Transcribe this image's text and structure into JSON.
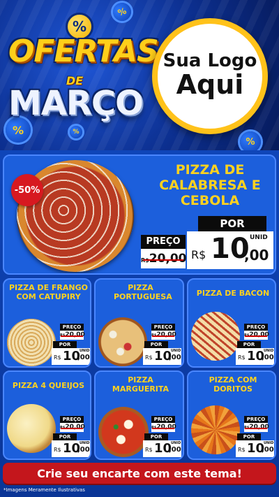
{
  "header": {
    "badge_symbol": "%",
    "title_line1": "OFERTAS",
    "title_line2": "DE",
    "title_line3": "MARÇO",
    "logo_line1": "Sua Logo",
    "logo_line2": "Aqui"
  },
  "featured": {
    "discount": "-50%",
    "name": "PIZZA DE CALABRESA E CEBOLA",
    "old_label": "PREÇO",
    "old_currency": "R$",
    "old_price": "20,00",
    "new_label": "POR",
    "unit": "UNID",
    "currency": "R$",
    "price_int": "10",
    "price_dec": ",00"
  },
  "products": [
    {
      "name": "PIZZA DE FRANGO COM CATUPIRY",
      "old_label": "PREÇO",
      "old_currency": "R$",
      "old_price": "20,00",
      "new_label": "POR",
      "unit": "UNID",
      "currency": "R$",
      "price_int": "10",
      "price_dec": ",00"
    },
    {
      "name": "PIZZA PORTUGUESA",
      "old_label": "PREÇO",
      "old_currency": "R$",
      "old_price": "20,00",
      "new_label": "POR",
      "unit": "UNID",
      "currency": "R$",
      "price_int": "10",
      "price_dec": ",00"
    },
    {
      "name": "PIZZA DE BACON",
      "old_label": "PREÇO",
      "old_currency": "R$",
      "old_price": "20,00",
      "new_label": "POR",
      "unit": "UNID",
      "currency": "R$",
      "price_int": "10",
      "price_dec": ",00"
    },
    {
      "name": "PIZZA 4 QUEIJOS",
      "old_label": "PREÇO",
      "old_currency": "R$",
      "old_price": "20,00",
      "new_label": "POR",
      "unit": "UNID",
      "currency": "R$",
      "price_int": "10",
      "price_dec": ",00"
    },
    {
      "name": "PIZZA MARGUERITA",
      "old_label": "PREÇO",
      "old_currency": "R$",
      "old_price": "20,00",
      "new_label": "POR",
      "unit": "UNID",
      "currency": "R$",
      "price_int": "10",
      "price_dec": ",00"
    },
    {
      "name": "PIZZA COM DORITOS",
      "old_label": "PREÇO",
      "old_currency": "R$",
      "old_price": "20,00",
      "new_label": "POR",
      "unit": "UNID",
      "currency": "R$",
      "price_int": "10",
      "price_dec": ",00"
    }
  ],
  "cta_label": "Crie seu encarte com este tema!",
  "footnote": "*Imagens Meramente Ilustrativas",
  "colors": {
    "accent_yellow": "#ffd21f",
    "panel_blue": "#1c5fdc",
    "cta_red": "#c4161c"
  }
}
